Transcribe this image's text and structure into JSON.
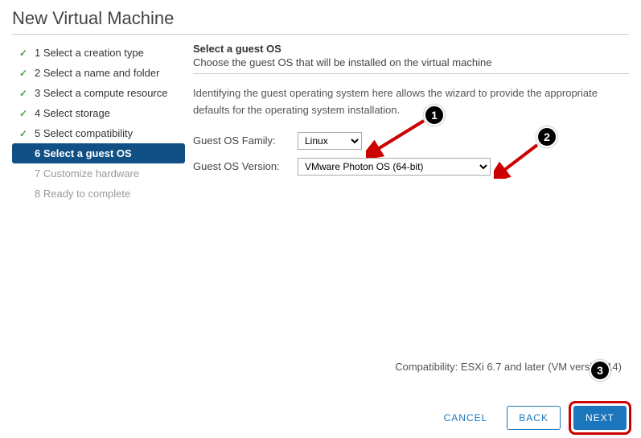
{
  "title": "New Virtual Machine",
  "steps": [
    {
      "n": "1",
      "label": "Select a creation type",
      "state": "done"
    },
    {
      "n": "2",
      "label": "Select a name and folder",
      "state": "done"
    },
    {
      "n": "3",
      "label": "Select a compute resource",
      "state": "done"
    },
    {
      "n": "4",
      "label": "Select storage",
      "state": "done"
    },
    {
      "n": "5",
      "label": "Select compatibility",
      "state": "done"
    },
    {
      "n": "6",
      "label": "Select a guest OS",
      "state": "active"
    },
    {
      "n": "7",
      "label": "Customize hardware",
      "state": "future"
    },
    {
      "n": "8",
      "label": "Ready to complete",
      "state": "future"
    }
  ],
  "main": {
    "heading": "Select a guest OS",
    "sub": "Choose the guest OS that will be installed on the virtual machine",
    "desc": "Identifying the guest operating system here allows the wizard to provide the appropriate defaults for the operating system installation.",
    "family_label": "Guest OS Family:",
    "family_value": "Linux",
    "version_label": "Guest OS Version:",
    "version_value": "VMware Photon OS (64-bit)"
  },
  "compat": "Compatibility: ESXi 6.7 and later (VM version 14)",
  "buttons": {
    "cancel": "CANCEL",
    "back": "BACK",
    "next": "NEXT"
  },
  "callouts": {
    "c1": "1",
    "c2": "2",
    "c3": "3"
  }
}
